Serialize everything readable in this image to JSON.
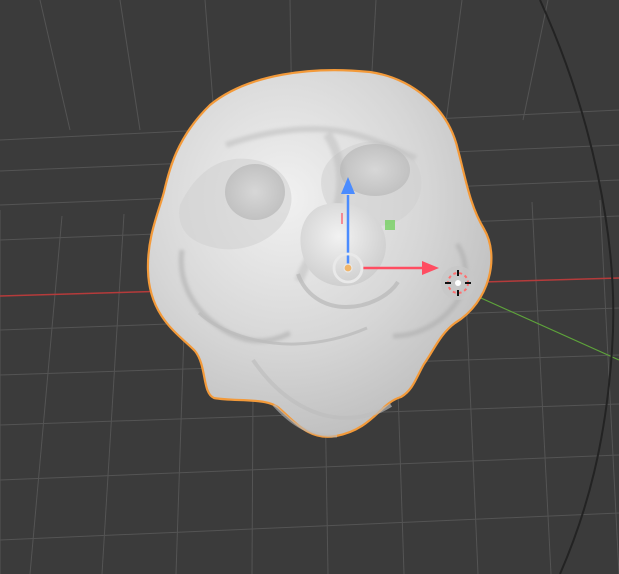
{
  "viewport": {
    "background_color": "#3b3b3b",
    "grid_color": "#575757",
    "x_axis_color": "#b53b3b",
    "y_axis_color": "#5ea33b",
    "mesh_color": "#d8d8d8",
    "selection_outline_color": "#f39a3a"
  },
  "object": {
    "name": "",
    "kind": "sculpt-head-mesh"
  },
  "gizmo": {
    "x_color": "#ff4d61",
    "y_color": "#6fd05a",
    "z_color": "#4b8cff",
    "center_color": "#e9e9e9",
    "origin_color": "#f0b56a",
    "icons": {
      "move_z": "arrow-up-icon",
      "move_x": "arrow-right-icon",
      "plane_handle": "plane-handle-icon",
      "center_handle": "center-handle-icon",
      "cursor": "3d-cursor-icon"
    }
  }
}
